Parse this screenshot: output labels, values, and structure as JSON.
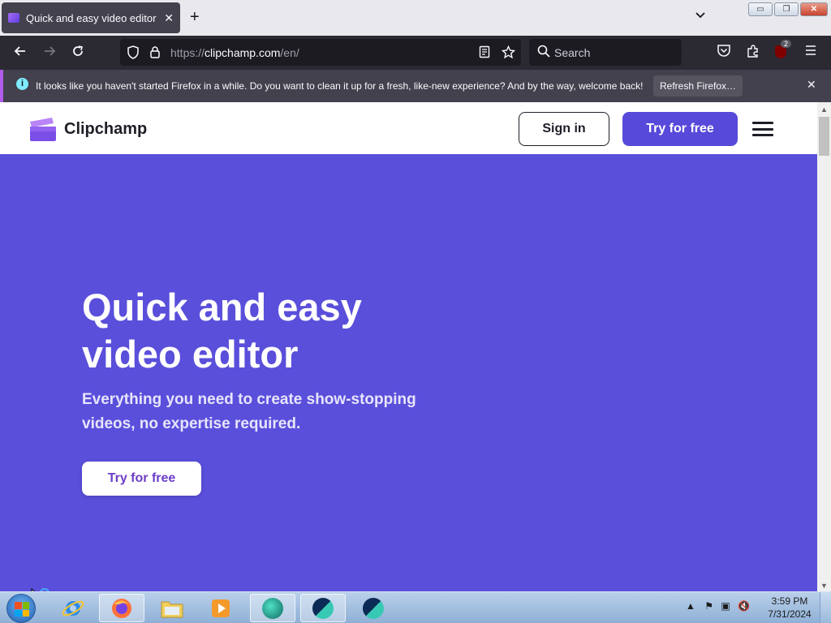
{
  "browser": {
    "tab_title": "Quick and easy video editor | Cl",
    "tab_close": "✕",
    "new_tab": "+",
    "tab_list": "⌄",
    "window_buttons": {
      "minimize": "▭",
      "restore": "❐",
      "close": "✕"
    },
    "url_proto": "https://",
    "url_host": "clipchamp.com",
    "url_path": "/en/",
    "search_placeholder": "Search",
    "extensions_badge": "2"
  },
  "notification": {
    "message": "It looks like you haven't started Firefox in a while. Do you want to clean it up for a fresh, like-new experience? And by the way, welcome back!",
    "button": "Refresh Firefox…",
    "close": "✕"
  },
  "site": {
    "logo_text": "Clipchamp",
    "sign_in": "Sign in",
    "try_free_header": "Try for free",
    "hero_title": "Quick and easy video editor",
    "hero_subtitle": "Everything you need to create show-stopping videos, no expertise required.",
    "try_free_hero": "Try for free"
  },
  "taskbar": {
    "time": "3:59 PM",
    "date": "7/31/2024"
  },
  "colors": {
    "hero_bg": "#5a4fdb",
    "accent_button": "#5749d9"
  }
}
